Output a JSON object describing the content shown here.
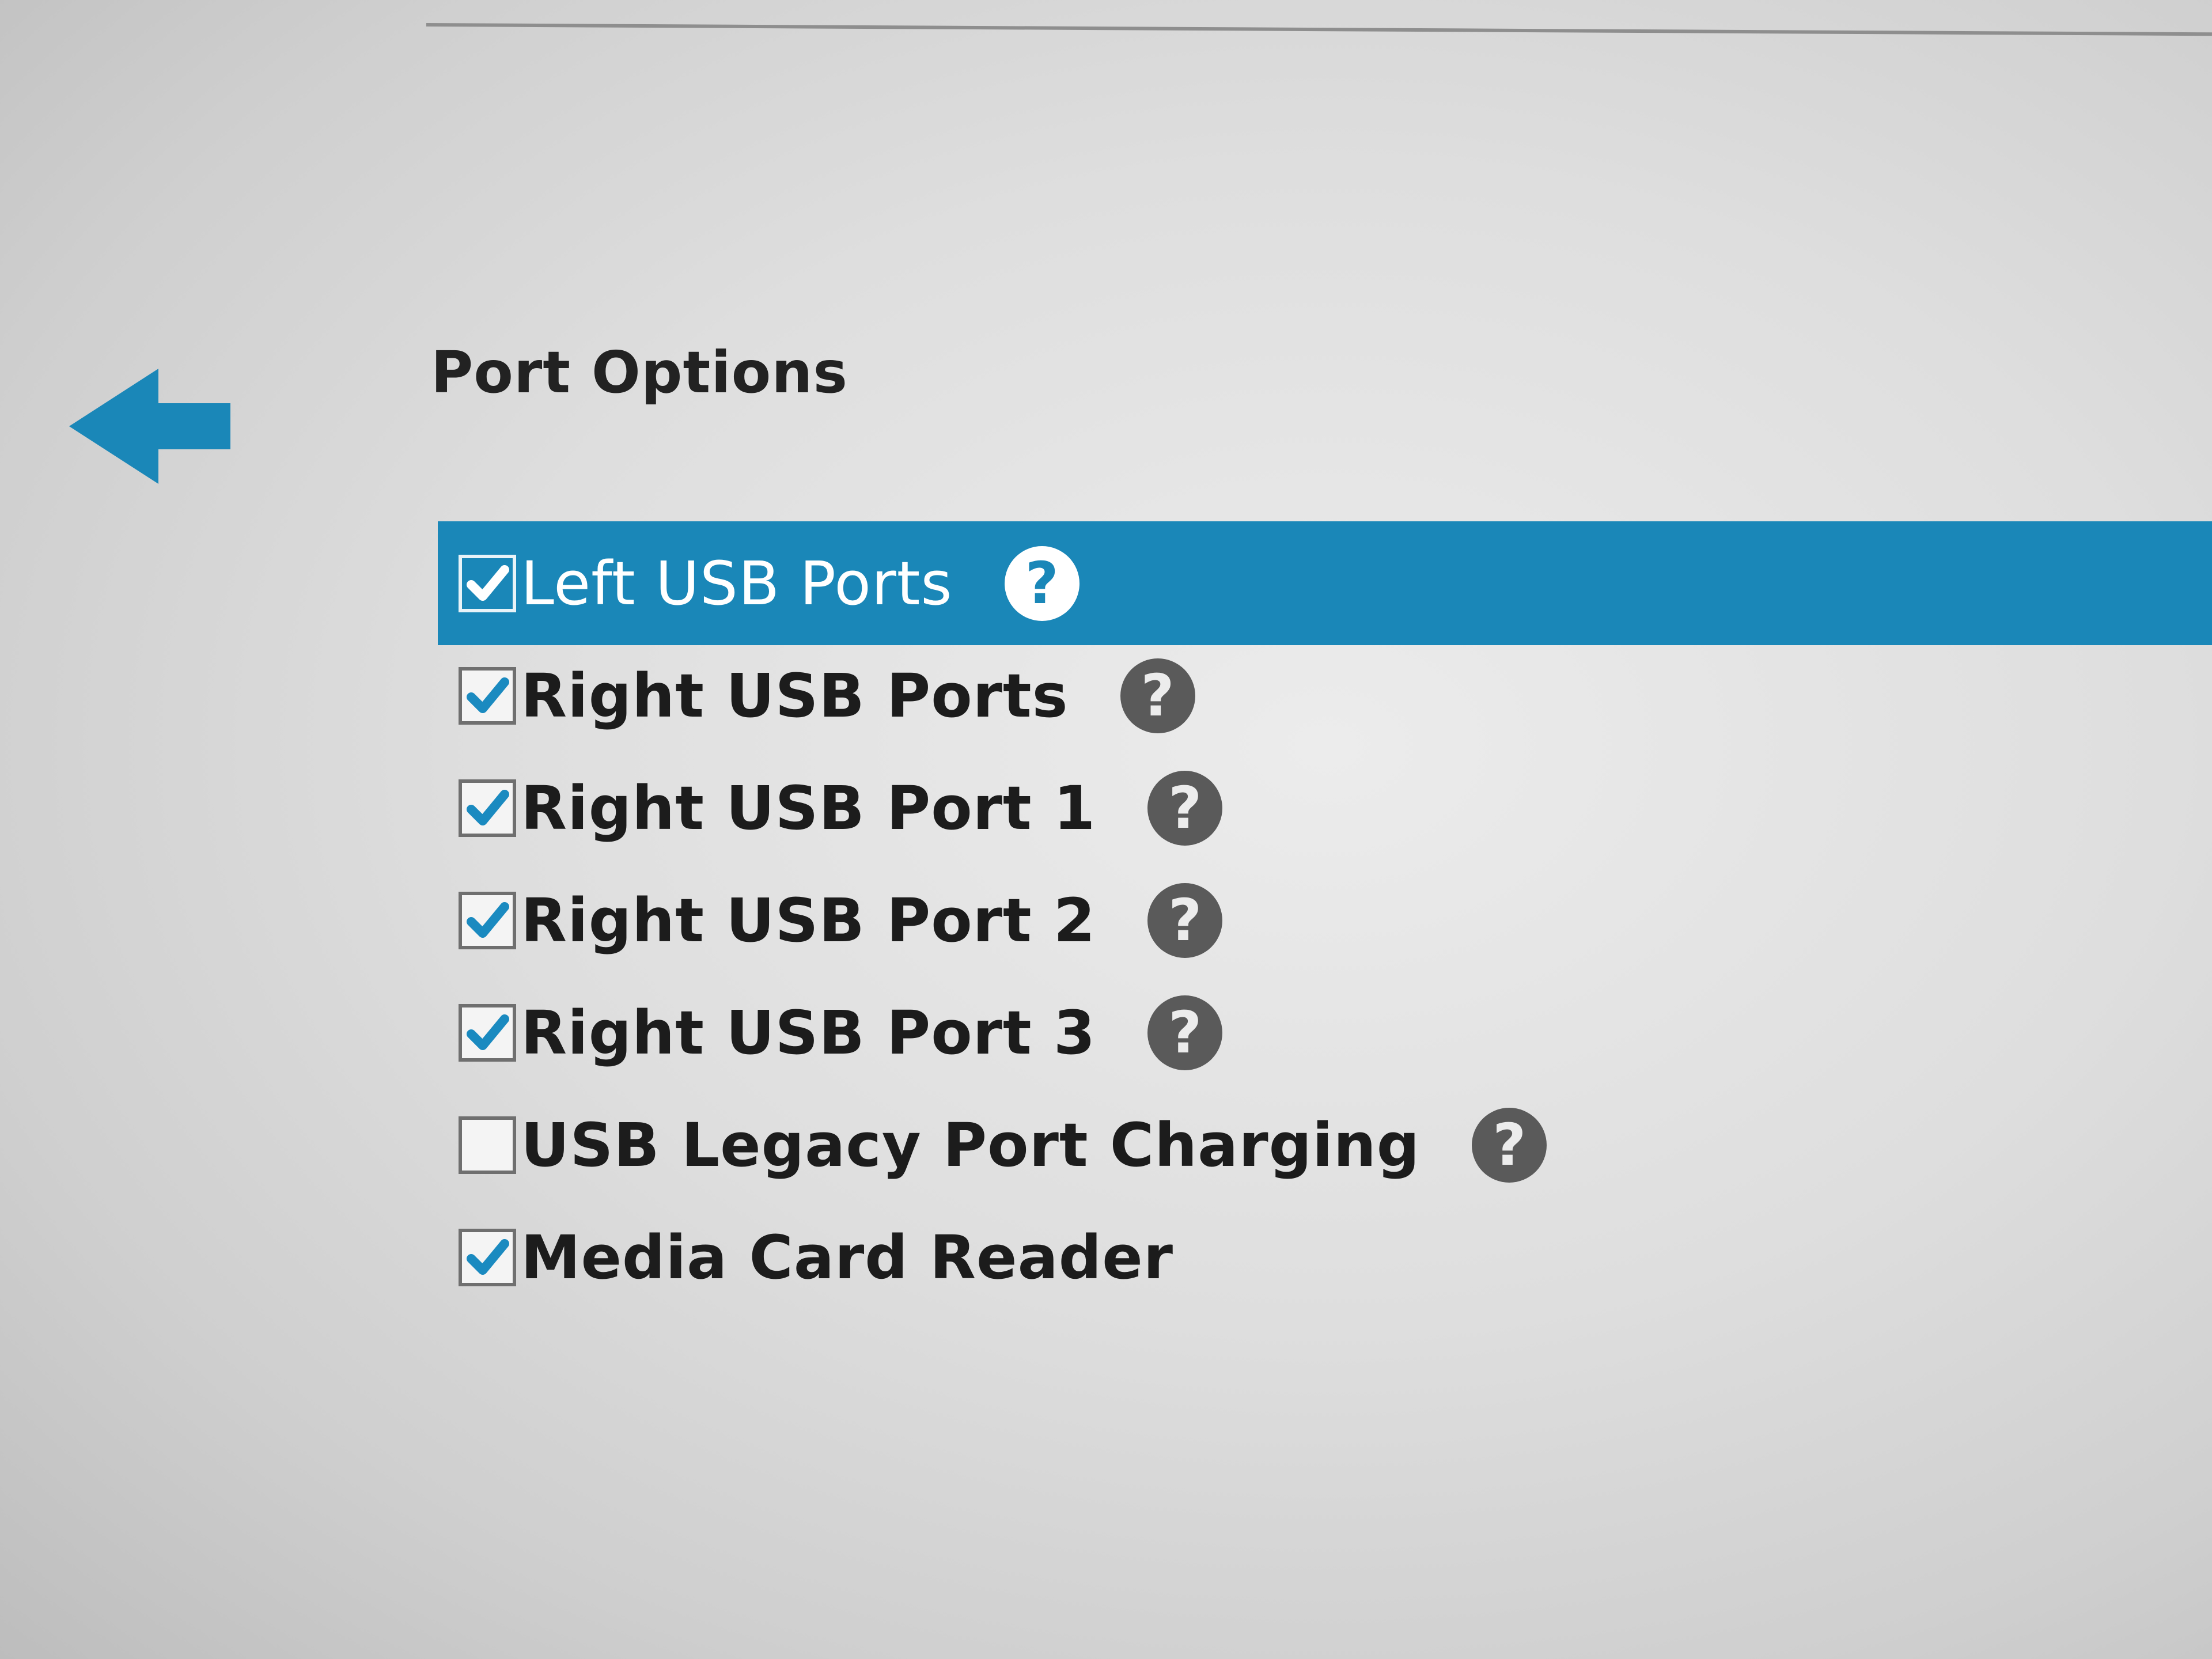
{
  "page": {
    "title": "Port Options",
    "back_icon": "arrow-left-icon",
    "accent_color": "#1a87b8"
  },
  "options": [
    {
      "label": "Left USB Ports",
      "checked": true,
      "selected": true,
      "help_icon": "question-circle-icon"
    },
    {
      "label": "Right USB Ports",
      "checked": true,
      "selected": false,
      "help_icon": "question-circle-icon"
    },
    {
      "label": "Right USB Port 1",
      "checked": true,
      "selected": false,
      "help_icon": "question-circle-icon"
    },
    {
      "label": "Right USB Port 2",
      "checked": true,
      "selected": false,
      "help_icon": "question-circle-icon"
    },
    {
      "label": "Right USB Port 3",
      "checked": true,
      "selected": false,
      "help_icon": "question-circle-icon"
    },
    {
      "label": "USB Legacy Port Charging",
      "checked": false,
      "selected": false,
      "help_icon": "question-circle-icon"
    },
    {
      "label": "Media Card Reader",
      "checked": true,
      "selected": false,
      "help_icon": null
    }
  ]
}
